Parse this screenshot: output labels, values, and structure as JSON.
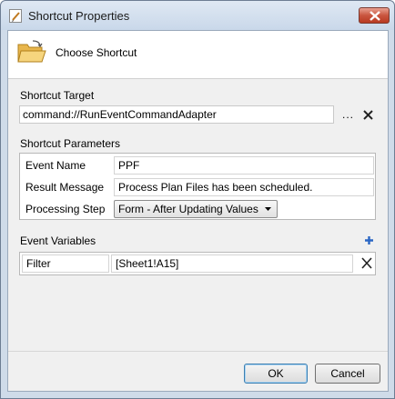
{
  "window": {
    "title": "Shortcut Properties"
  },
  "header": {
    "title": "Choose Shortcut"
  },
  "target": {
    "label": "Shortcut Target",
    "value": "command://RunEventCommandAdapter",
    "browse_label": "..."
  },
  "parameters": {
    "label": "Shortcut Parameters",
    "rows": [
      {
        "label": "Event Name",
        "value": "PPF"
      },
      {
        "label": "Result Message",
        "value": "Process Plan Files has been scheduled."
      },
      {
        "label": "Processing Step",
        "value": "Form - After Updating Values"
      }
    ]
  },
  "variables": {
    "label": "Event Variables",
    "items": [
      {
        "name": "Filter",
        "value": "[Sheet1!A15]"
      }
    ]
  },
  "buttons": {
    "ok": "OK",
    "cancel": "Cancel"
  },
  "colors": {
    "accent": "#3c7fb1",
    "close": "#c9553f",
    "add_icon": "#2a66c4"
  },
  "icons": {
    "title": "document-icon",
    "close": "close-icon",
    "header": "folder-open-icon",
    "clear_target": "x-icon",
    "add_variable": "plus-icon",
    "remove_variable": "x-icon",
    "dropdown": "chevron-down-icon"
  }
}
